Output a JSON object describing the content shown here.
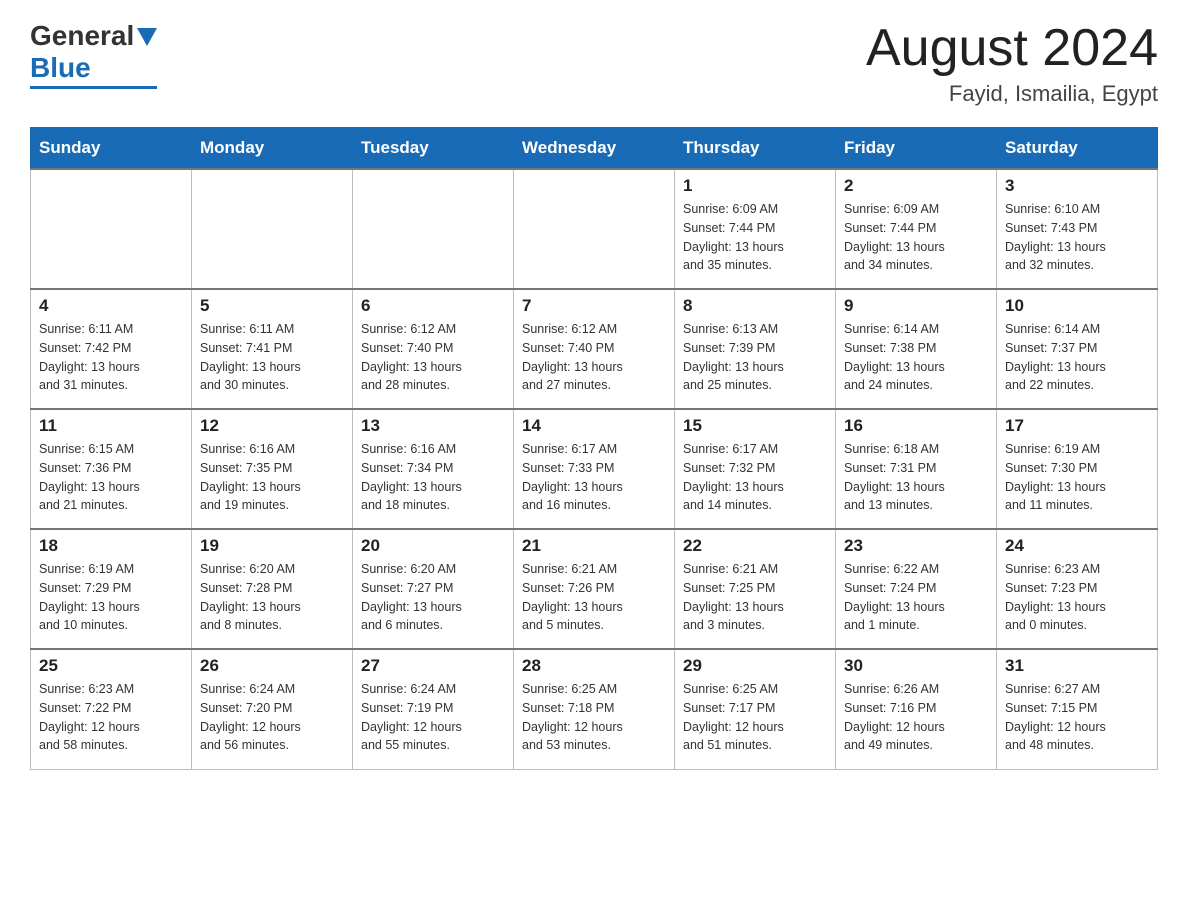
{
  "header": {
    "logo_general": "General",
    "logo_blue": "Blue",
    "month_title": "August 2024",
    "location": "Fayid, Ismailia, Egypt"
  },
  "weekdays": [
    "Sunday",
    "Monday",
    "Tuesday",
    "Wednesday",
    "Thursday",
    "Friday",
    "Saturday"
  ],
  "weeks": [
    [
      {
        "day": "",
        "info": ""
      },
      {
        "day": "",
        "info": ""
      },
      {
        "day": "",
        "info": ""
      },
      {
        "day": "",
        "info": ""
      },
      {
        "day": "1",
        "info": "Sunrise: 6:09 AM\nSunset: 7:44 PM\nDaylight: 13 hours\nand 35 minutes."
      },
      {
        "day": "2",
        "info": "Sunrise: 6:09 AM\nSunset: 7:44 PM\nDaylight: 13 hours\nand 34 minutes."
      },
      {
        "day": "3",
        "info": "Sunrise: 6:10 AM\nSunset: 7:43 PM\nDaylight: 13 hours\nand 32 minutes."
      }
    ],
    [
      {
        "day": "4",
        "info": "Sunrise: 6:11 AM\nSunset: 7:42 PM\nDaylight: 13 hours\nand 31 minutes."
      },
      {
        "day": "5",
        "info": "Sunrise: 6:11 AM\nSunset: 7:41 PM\nDaylight: 13 hours\nand 30 minutes."
      },
      {
        "day": "6",
        "info": "Sunrise: 6:12 AM\nSunset: 7:40 PM\nDaylight: 13 hours\nand 28 minutes."
      },
      {
        "day": "7",
        "info": "Sunrise: 6:12 AM\nSunset: 7:40 PM\nDaylight: 13 hours\nand 27 minutes."
      },
      {
        "day": "8",
        "info": "Sunrise: 6:13 AM\nSunset: 7:39 PM\nDaylight: 13 hours\nand 25 minutes."
      },
      {
        "day": "9",
        "info": "Sunrise: 6:14 AM\nSunset: 7:38 PM\nDaylight: 13 hours\nand 24 minutes."
      },
      {
        "day": "10",
        "info": "Sunrise: 6:14 AM\nSunset: 7:37 PM\nDaylight: 13 hours\nand 22 minutes."
      }
    ],
    [
      {
        "day": "11",
        "info": "Sunrise: 6:15 AM\nSunset: 7:36 PM\nDaylight: 13 hours\nand 21 minutes."
      },
      {
        "day": "12",
        "info": "Sunrise: 6:16 AM\nSunset: 7:35 PM\nDaylight: 13 hours\nand 19 minutes."
      },
      {
        "day": "13",
        "info": "Sunrise: 6:16 AM\nSunset: 7:34 PM\nDaylight: 13 hours\nand 18 minutes."
      },
      {
        "day": "14",
        "info": "Sunrise: 6:17 AM\nSunset: 7:33 PM\nDaylight: 13 hours\nand 16 minutes."
      },
      {
        "day": "15",
        "info": "Sunrise: 6:17 AM\nSunset: 7:32 PM\nDaylight: 13 hours\nand 14 minutes."
      },
      {
        "day": "16",
        "info": "Sunrise: 6:18 AM\nSunset: 7:31 PM\nDaylight: 13 hours\nand 13 minutes."
      },
      {
        "day": "17",
        "info": "Sunrise: 6:19 AM\nSunset: 7:30 PM\nDaylight: 13 hours\nand 11 minutes."
      }
    ],
    [
      {
        "day": "18",
        "info": "Sunrise: 6:19 AM\nSunset: 7:29 PM\nDaylight: 13 hours\nand 10 minutes."
      },
      {
        "day": "19",
        "info": "Sunrise: 6:20 AM\nSunset: 7:28 PM\nDaylight: 13 hours\nand 8 minutes."
      },
      {
        "day": "20",
        "info": "Sunrise: 6:20 AM\nSunset: 7:27 PM\nDaylight: 13 hours\nand 6 minutes."
      },
      {
        "day": "21",
        "info": "Sunrise: 6:21 AM\nSunset: 7:26 PM\nDaylight: 13 hours\nand 5 minutes."
      },
      {
        "day": "22",
        "info": "Sunrise: 6:21 AM\nSunset: 7:25 PM\nDaylight: 13 hours\nand 3 minutes."
      },
      {
        "day": "23",
        "info": "Sunrise: 6:22 AM\nSunset: 7:24 PM\nDaylight: 13 hours\nand 1 minute."
      },
      {
        "day": "24",
        "info": "Sunrise: 6:23 AM\nSunset: 7:23 PM\nDaylight: 13 hours\nand 0 minutes."
      }
    ],
    [
      {
        "day": "25",
        "info": "Sunrise: 6:23 AM\nSunset: 7:22 PM\nDaylight: 12 hours\nand 58 minutes."
      },
      {
        "day": "26",
        "info": "Sunrise: 6:24 AM\nSunset: 7:20 PM\nDaylight: 12 hours\nand 56 minutes."
      },
      {
        "day": "27",
        "info": "Sunrise: 6:24 AM\nSunset: 7:19 PM\nDaylight: 12 hours\nand 55 minutes."
      },
      {
        "day": "28",
        "info": "Sunrise: 6:25 AM\nSunset: 7:18 PM\nDaylight: 12 hours\nand 53 minutes."
      },
      {
        "day": "29",
        "info": "Sunrise: 6:25 AM\nSunset: 7:17 PM\nDaylight: 12 hours\nand 51 minutes."
      },
      {
        "day": "30",
        "info": "Sunrise: 6:26 AM\nSunset: 7:16 PM\nDaylight: 12 hours\nand 49 minutes."
      },
      {
        "day": "31",
        "info": "Sunrise: 6:27 AM\nSunset: 7:15 PM\nDaylight: 12 hours\nand 48 minutes."
      }
    ]
  ]
}
